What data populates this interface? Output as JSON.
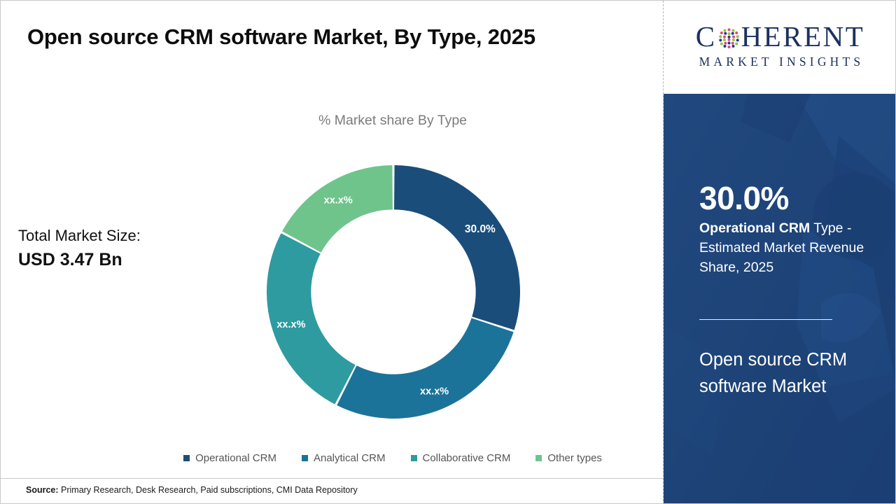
{
  "title": "Open source CRM software Market, By Type, 2025",
  "subtitle": "% Market share By Type",
  "total_market": {
    "label": "Total Market Size:",
    "value": "USD 3.47 Bn"
  },
  "source": {
    "label": "Source:",
    "text": " Primary Research, Desk Research, Paid subscriptions, CMI Data Repository"
  },
  "logo": {
    "word_before": "C",
    "word_after": "HERENT",
    "subtitle": "MARKET INSIGHTS",
    "o_icon": "dotted-sphere-icon",
    "color": "#1b3160"
  },
  "sidebar": {
    "stat_value": "30.0%",
    "stat_caption_bold": " Operational CRM",
    "stat_caption_rest": " Type - Estimated Market Revenue Share, 2025",
    "market_name": "Open source CRM software Market",
    "background_color": "#1d4379"
  },
  "chart_data": {
    "type": "pie",
    "variant": "donut",
    "title": "Open source CRM software Market, By Type, 2025",
    "subtitle": "% Market share By Type",
    "categories": [
      "Operational CRM",
      "Analytical CRM",
      "Collaborative CRM",
      "Other types"
    ],
    "values": [
      30.0,
      27.5,
      25.3,
      17.2
    ],
    "labels": [
      "30.0%",
      "xx.x%",
      "xx.x%",
      "xx.x%"
    ],
    "colors": [
      "#1b4d7a",
      "#1c7399",
      "#2e9ba0",
      "#6fc48c"
    ],
    "start_angle_deg": 0,
    "direction": "clockwise",
    "inner_radius_ratio": 0.65,
    "legend_position": "bottom",
    "grid": false,
    "total_label": "Total Market Size:",
    "total_value": "USD 3.47 Bn",
    "units": "percent"
  }
}
